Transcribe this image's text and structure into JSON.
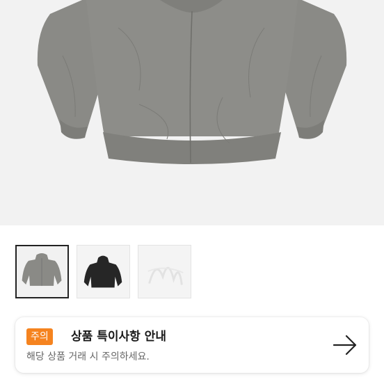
{
  "product_image": {
    "colors": {
      "background": "#f2f2f2",
      "jacket": "#8a8a86"
    }
  },
  "thumbnails": [
    {
      "variant": "gray",
      "selected": true,
      "color": "#8a8a86"
    },
    {
      "variant": "black",
      "selected": false,
      "color": "#262626"
    },
    {
      "variant": "white",
      "selected": false,
      "color": "#f4f4f4"
    }
  ],
  "notice": {
    "badge": "주의",
    "title": "상품 특이사항 안내",
    "subtitle": "해당 상품 거래 시 주의하세요.",
    "icon": "arrow-right-icon",
    "accent_color": "#f5831f"
  }
}
